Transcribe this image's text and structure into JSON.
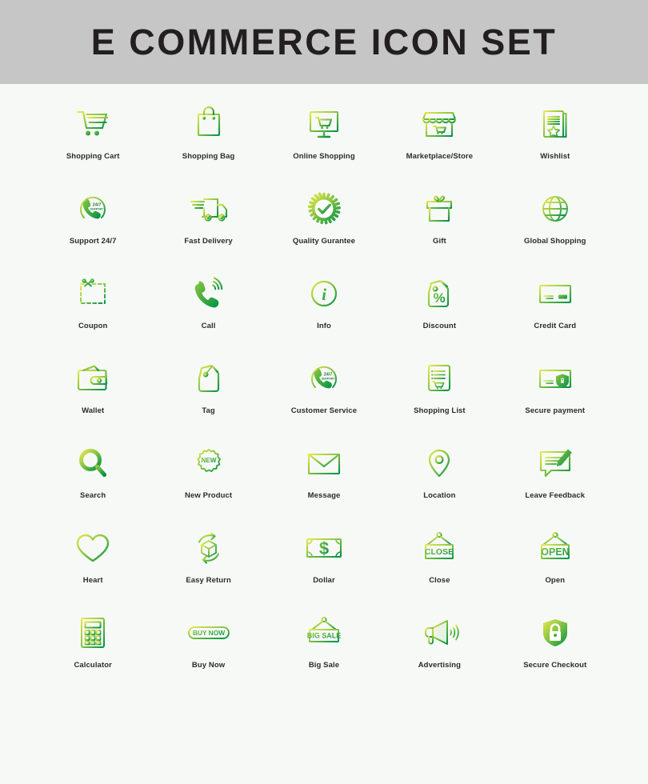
{
  "header": {
    "title": "E COMMERCE ICON SET",
    "background": "#c6c6c6",
    "text_color": "#231f20"
  },
  "page": {
    "background": "#f7f9f7",
    "label_color": "#2b2b2b"
  },
  "palette": {
    "gradient_start": "#e3e755",
    "gradient_mid": "#8cc63f",
    "gradient_end": "#009245",
    "accent_green": "#39b54a"
  },
  "grid": {
    "columns": 5,
    "rows": 7,
    "count": 35
  },
  "icons": [
    {
      "label": "Shopping Cart",
      "icon": "shopping-cart-icon"
    },
    {
      "label": "Shopping Bag",
      "icon": "shopping-bag-icon"
    },
    {
      "label": "Online Shopping",
      "icon": "online-shopping-icon"
    },
    {
      "label": "Marketplace/Store",
      "icon": "marketplace-store-icon"
    },
    {
      "label": "Wishlist",
      "icon": "wishlist-icon"
    },
    {
      "label": "Support 24/7",
      "icon": "support-24-7-icon",
      "inner_text": "24/7",
      "inner_text2": "SUPPORT"
    },
    {
      "label": "Fast Delivery",
      "icon": "fast-delivery-icon"
    },
    {
      "label": "Quality Gurantee",
      "icon": "quality-guarantee-icon"
    },
    {
      "label": "Gift",
      "icon": "gift-icon"
    },
    {
      "label": "Global Shopping",
      "icon": "global-shopping-icon"
    },
    {
      "label": "Coupon",
      "icon": "coupon-icon"
    },
    {
      "label": "Call",
      "icon": "call-icon"
    },
    {
      "label": "Info",
      "icon": "info-icon",
      "inner_text": "i"
    },
    {
      "label": "Discount",
      "icon": "discount-icon",
      "inner_text": "%"
    },
    {
      "label": "Credit Card",
      "icon": "credit-card-icon"
    },
    {
      "label": "Wallet",
      "icon": "wallet-icon"
    },
    {
      "label": "Tag",
      "icon": "tag-icon"
    },
    {
      "label": "Customer Service",
      "icon": "customer-service-icon",
      "inner_text": "24/7",
      "inner_text2": "SUPPORT"
    },
    {
      "label": "Shopping List",
      "icon": "shopping-list-icon"
    },
    {
      "label": "Secure payment",
      "icon": "secure-payment-icon"
    },
    {
      "label": "Search",
      "icon": "search-icon"
    },
    {
      "label": "New Product",
      "icon": "new-product-icon",
      "inner_text": "NEW"
    },
    {
      "label": "Message",
      "icon": "message-icon"
    },
    {
      "label": "Location",
      "icon": "location-pin-icon"
    },
    {
      "label": "Leave Feedback",
      "icon": "leave-feedback-icon"
    },
    {
      "label": "Heart",
      "icon": "heart-icon"
    },
    {
      "label": "Easy Return",
      "icon": "easy-return-icon"
    },
    {
      "label": "Dollar",
      "icon": "dollar-icon",
      "inner_text": "$"
    },
    {
      "label": "Close",
      "icon": "close-sign-icon",
      "inner_text": "CLOSE"
    },
    {
      "label": "Open",
      "icon": "open-sign-icon",
      "inner_text": "OPEN"
    },
    {
      "label": "Calculator",
      "icon": "calculator-icon"
    },
    {
      "label": "Buy Now",
      "icon": "buy-now-icon",
      "inner_text": "BUY NOW"
    },
    {
      "label": "Big Sale",
      "icon": "big-sale-icon",
      "inner_text": "BIG SALE"
    },
    {
      "label": "Advertising",
      "icon": "advertising-megaphone-icon"
    },
    {
      "label": "Secure Checkout",
      "icon": "secure-checkout-icon"
    }
  ]
}
